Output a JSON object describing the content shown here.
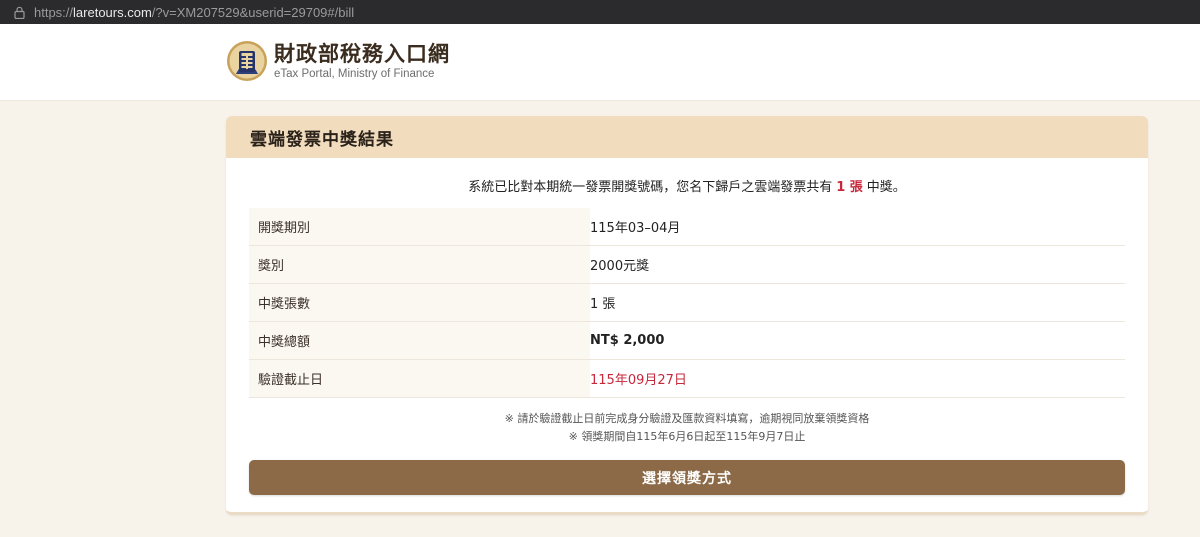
{
  "browser": {
    "url_scheme": "https://",
    "url_host": "laretours.com",
    "url_path": "/?v=XM207529&userid=29709#/bill",
    "lock_icon": "lock-icon"
  },
  "header": {
    "logo_icon": "etax-seal-icon",
    "site_name_cn": "財政部稅務入口網",
    "site_name_en": "eTax Portal, Ministry of Finance"
  },
  "card": {
    "title": "雲端發票中獎結果",
    "summary_prefix": "系統已比對本期統一發票開獎號碼，您名下歸戶之雲端發票共有",
    "summary_count": "1 張",
    "summary_suffix": "中獎。",
    "rows": [
      {
        "label": "開獎期別",
        "value": "115年03–04月"
      },
      {
        "label": "獎別",
        "value": "2000元獎"
      },
      {
        "label": "中獎張數",
        "value": "1 張"
      },
      {
        "label": "中獎總額",
        "value": "NT$ 2,000"
      },
      {
        "label": "驗證截止日",
        "value": "115年09月27日"
      }
    ],
    "notes": [
      "※ 請於驗證截止日前完成身分驗證及匯款資料填寫，逾期視同放棄領獎資格",
      "※ 領獎期間自115年6月6日起至115年9月7日止"
    ],
    "cta_label": "選擇領獎方式"
  },
  "colors": {
    "header_band": "#f1ddbe",
    "accent_red": "#c8283c",
    "button_brown": "#8c6a47",
    "page_bg": "#f7f2ea"
  }
}
